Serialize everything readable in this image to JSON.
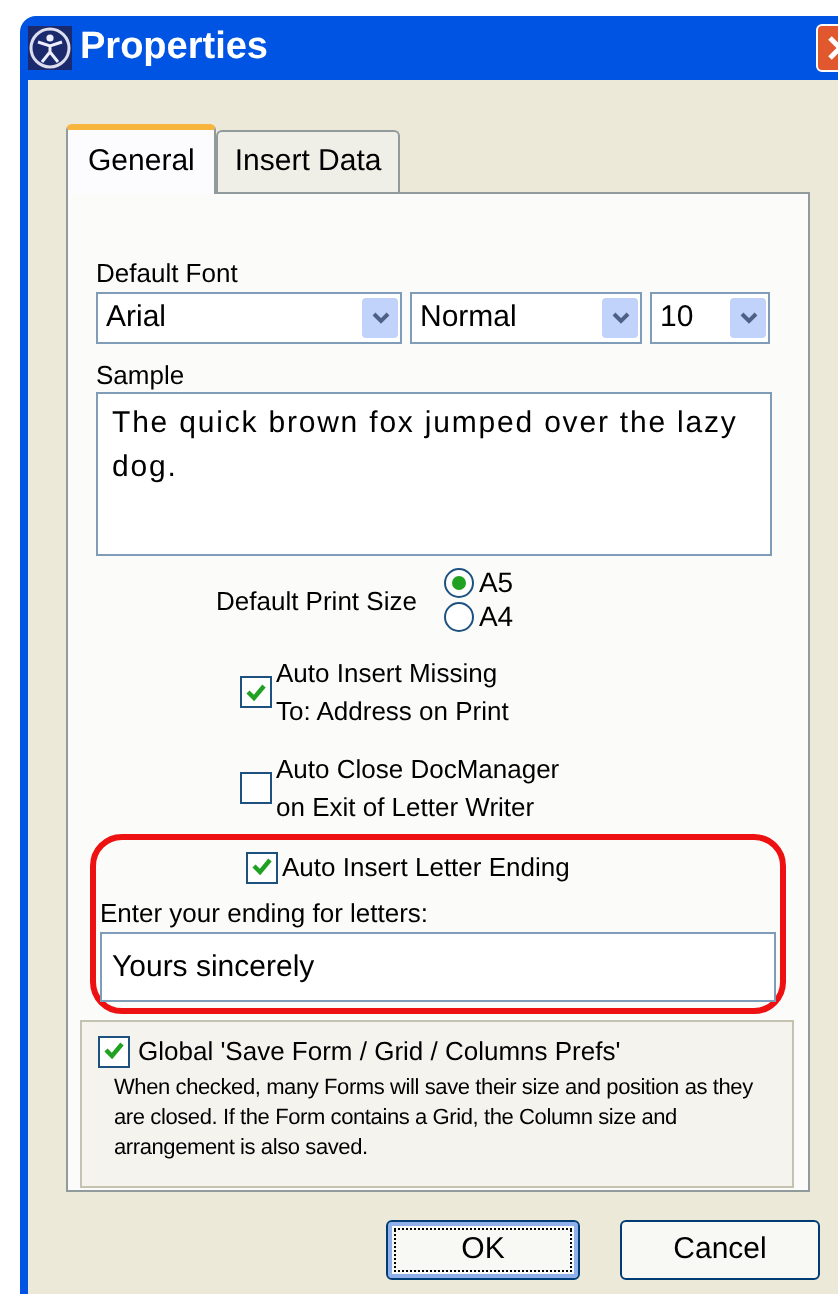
{
  "window": {
    "title": "Properties"
  },
  "tabs": [
    {
      "label": "General",
      "selected": true
    },
    {
      "label": "Insert Data",
      "selected": false
    }
  ],
  "default_font": {
    "label": "Default Font",
    "font": "Arial",
    "style": "Normal",
    "size": "10"
  },
  "sample": {
    "label": "Sample",
    "text": "The quick brown fox jumped over the lazy dog."
  },
  "print_size": {
    "label": "Default Print Size",
    "options": [
      {
        "label": "A5",
        "selected": true
      },
      {
        "label": "A4",
        "selected": false
      }
    ]
  },
  "checkboxes": [
    {
      "label": "Auto Insert Missing\nTo: Address on Print",
      "checked": true
    },
    {
      "label": "Auto Close DocManager\non Exit of Letter Writer",
      "checked": false
    }
  ],
  "letter_ending": {
    "checkbox": {
      "label": "Auto Insert Letter Ending",
      "checked": true
    },
    "field_label": "Enter your ending for letters:",
    "value": "Yours sincerely"
  },
  "global_prefs": {
    "label": "Global 'Save Form / Grid / Columns Prefs'",
    "checked": true,
    "description": "When checked, many Forms will save their size and position as they are closed. If the Form contains a Grid, the Column size and arrangement is also saved."
  },
  "buttons": [
    {
      "label": "OK",
      "kind": "default"
    },
    {
      "label": "Cancel",
      "kind": "normal"
    }
  ]
}
